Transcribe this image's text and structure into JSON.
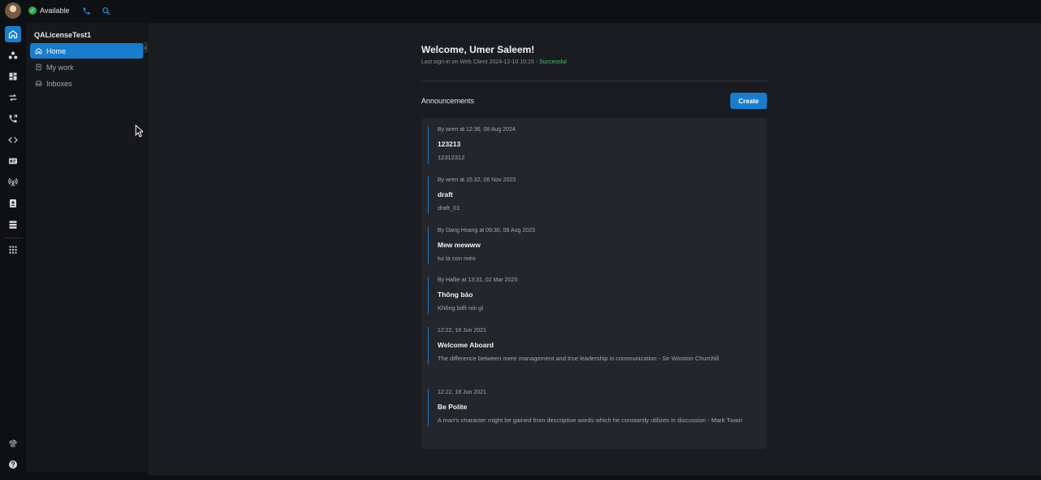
{
  "topbar": {
    "status_label": "Available",
    "phone_icon": "phone-icon",
    "search_icon": "search-icon"
  },
  "rail": {
    "items": [
      "home-icon",
      "people-icon",
      "dashboard-icon",
      "transfer-icon",
      "call-log-icon",
      "code-icon",
      "id-card-icon",
      "broadcast-icon",
      "contacts-icon",
      "storage-icon",
      "apps-grid-icon",
      "fingerprint-icon",
      "help-icon"
    ]
  },
  "sidebar": {
    "workspace": "QALicenseTest1",
    "items": [
      {
        "label": "Home",
        "icon": "home-icon"
      },
      {
        "label": "My work",
        "icon": "clipboard-icon"
      },
      {
        "label": "Inboxes",
        "icon": "inbox-icon"
      }
    ]
  },
  "main": {
    "welcome": "Welcome, Umer Saleem!",
    "signin_text": "Last sign-in on Web Client 2024-12-10 10:15 - ",
    "signin_status": "Successful",
    "announcements_title": "Announcements",
    "create_label": "Create",
    "announcements": [
      {
        "meta": "By wren at 12:36, 08 Aug 2024",
        "title": "123213",
        "body": "12312312"
      },
      {
        "meta": "By wren at 15:32, 06 Nov 2023",
        "title": "draft",
        "body": "draft_01"
      },
      {
        "meta": "By Dang Hoang at 09:30, 08 Aug 2023",
        "title": "Mew mewww",
        "body": "tui là con mèo"
      },
      {
        "meta": "By Hallie at 13:31, 02 Mar 2023",
        "title": "Thông báo",
        "body": "Không biết nói gì"
      },
      {
        "meta": "12:22, 18 Jun 2021",
        "title": "Welcome Aboard",
        "body": "The difference between mere management and true leadership is communication - Sir Winston Churchill"
      },
      {
        "meta": "12:22, 18 Jun 2021",
        "title": "Be Polite",
        "body": "A man's character might be gained from descriptive words which he constantly utilizes in discussion - Mark Twain"
      }
    ]
  },
  "colors": {
    "accent": "#1a7ccc",
    "success": "#4cc06a",
    "status_green": "#2eaa4e",
    "background": "#1b1c21",
    "panel": "#24262b"
  }
}
